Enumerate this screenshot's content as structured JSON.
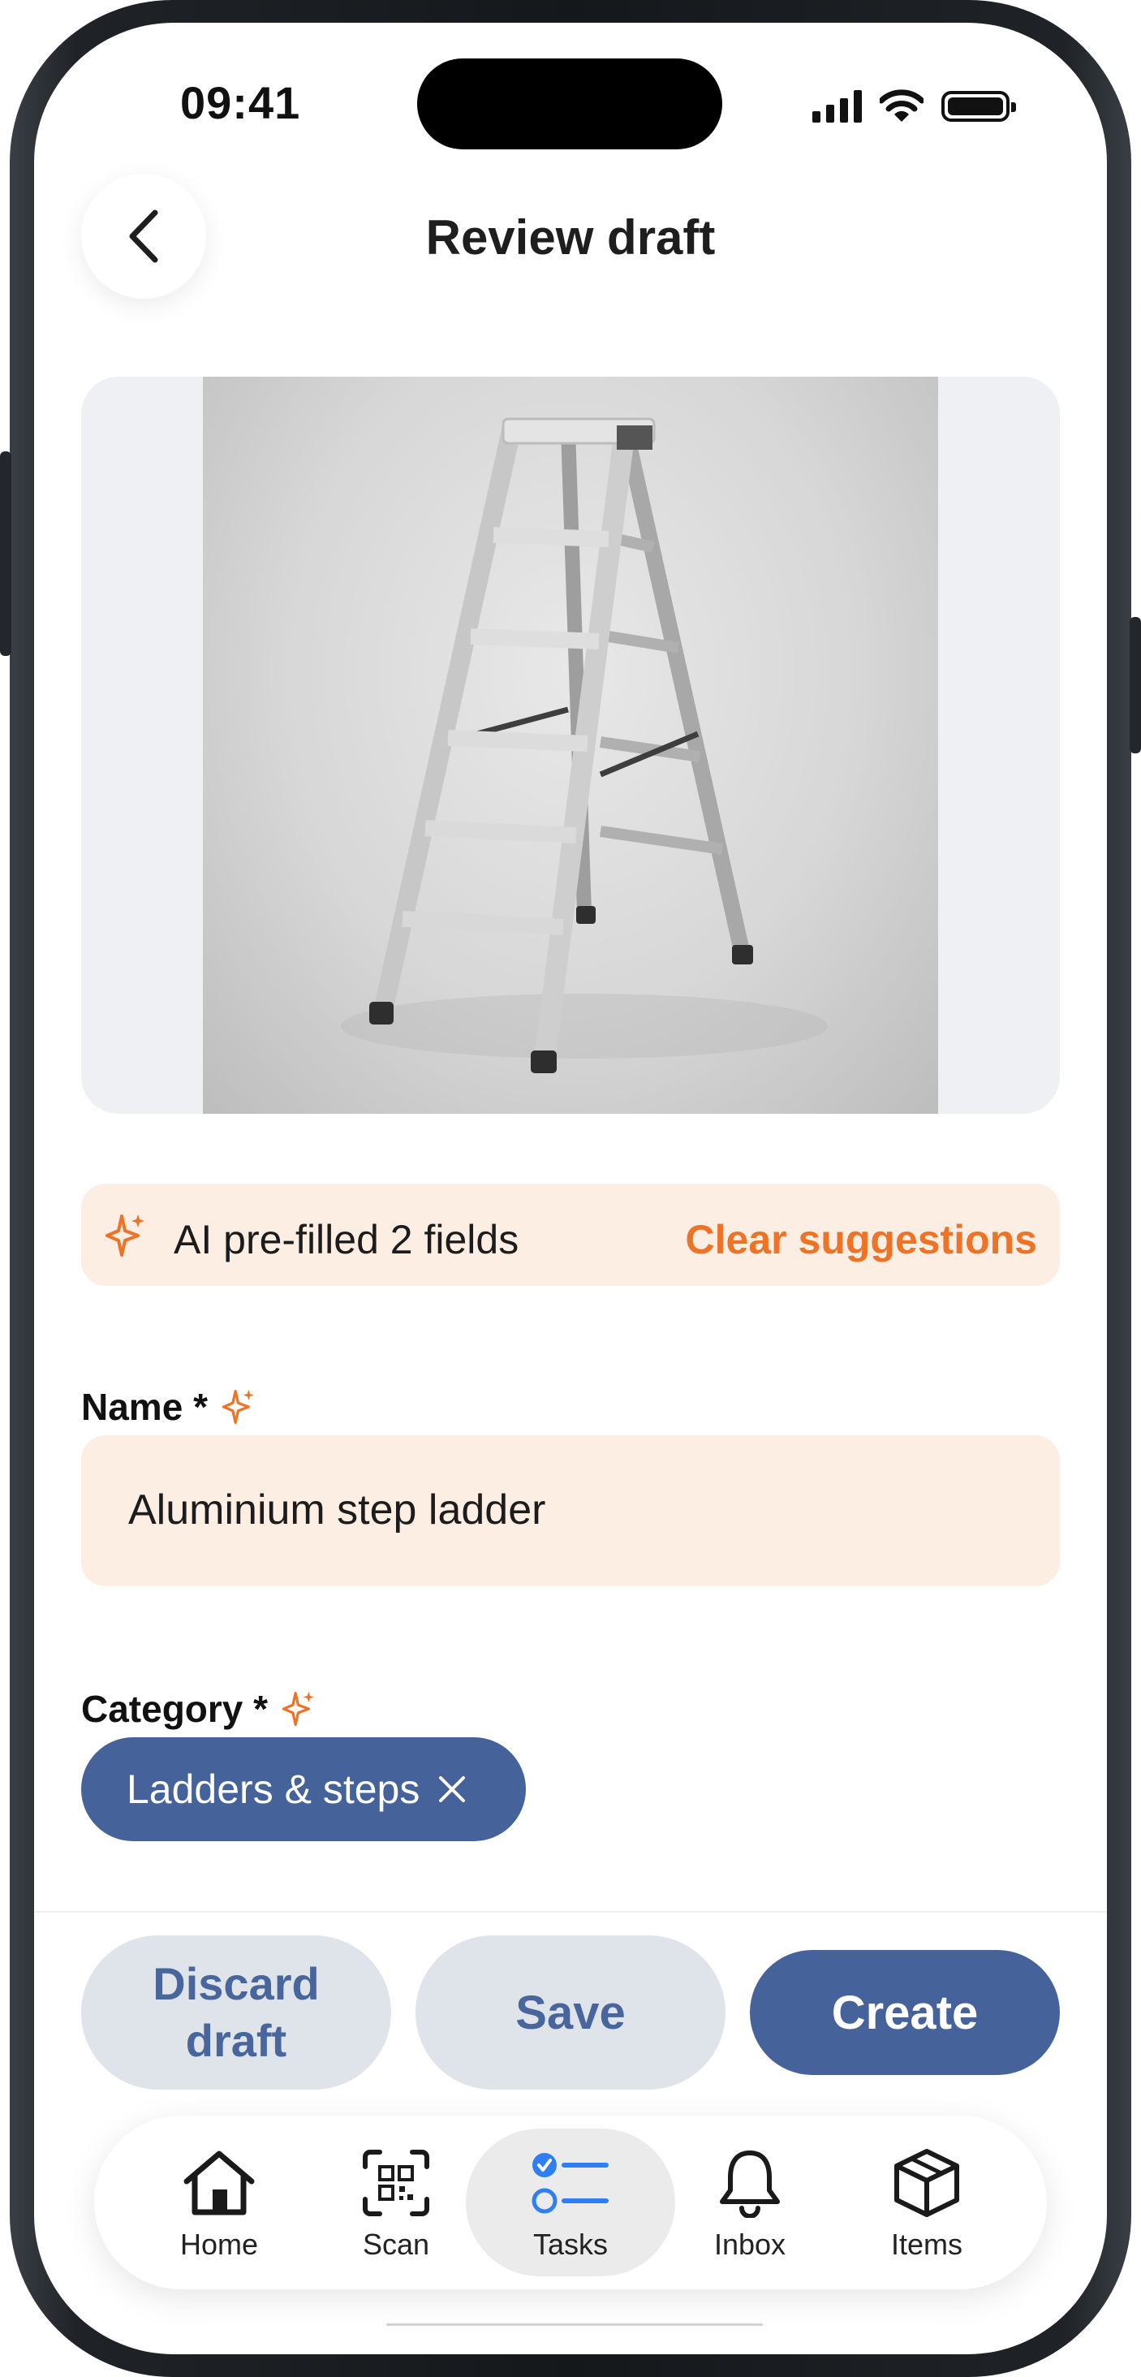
{
  "status_bar": {
    "time": "09:41"
  },
  "header": {
    "title": "Review draft",
    "back_icon": "chevron-left-icon"
  },
  "photo": {
    "alt": "step ladder"
  },
  "ai_banner": {
    "icon": "sparkle-icon",
    "text": "AI pre-filled 2 fields",
    "action": "Clear suggestions",
    "accent": "#EE7326",
    "background": "#FDEEE4"
  },
  "form": {
    "name": {
      "label": "Name *",
      "value": "Aluminium step ladder"
    },
    "category": {
      "label": "Category *",
      "chips": [
        {
          "label": "Ladders & steps"
        }
      ]
    }
  },
  "actions": {
    "discard": "Discard draft",
    "save": "Save",
    "create": "Create",
    "primary_color": "#46629A",
    "secondary_color": "#DFE4EB"
  },
  "tabbar": {
    "active": "Tasks",
    "items": [
      {
        "label": "Home",
        "icon": "home-icon"
      },
      {
        "label": "Scan",
        "icon": "qr-scan-icon"
      },
      {
        "label": "Tasks",
        "icon": "tasks-icon"
      },
      {
        "label": "Inbox",
        "icon": "bell-icon"
      },
      {
        "label": "Items",
        "icon": "box-icon"
      }
    ]
  }
}
